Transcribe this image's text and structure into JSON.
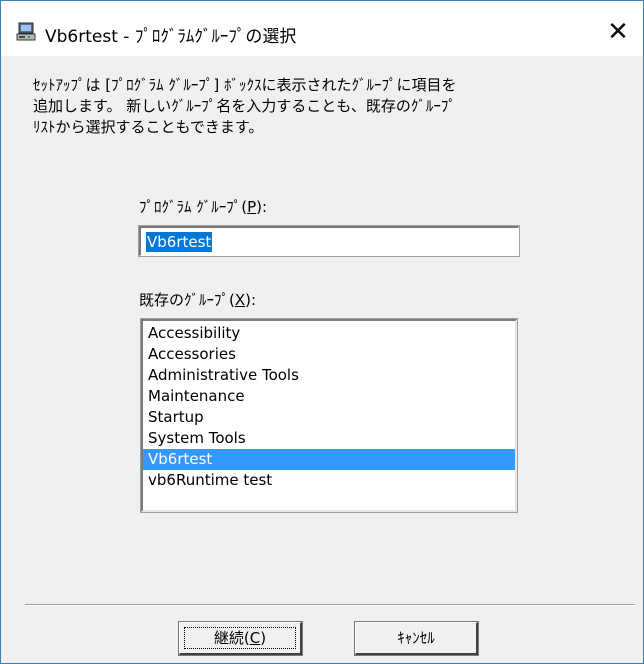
{
  "window": {
    "title": "Vb6rtest - ﾌﾟﾛｸﾞﾗﾑｸﾞﾙｰﾌﾟの選択",
    "close_glyph": "✕",
    "icon": "setup-computer-icon"
  },
  "instructions": "ｾｯﾄｱｯﾌﾟは [ﾌﾟﾛｸﾞﾗﾑ ｸﾞﾙｰﾌﾟ] ﾎﾞｯｸｽに表示されたｸﾞﾙｰﾌﾟに項目を\n追加します。 新しいｸﾞﾙｰﾌﾟ名を入力することも、既存のｸﾞﾙｰﾌﾟ\nﾘｽﾄから選択することもできます。",
  "program_group": {
    "label_pre": "ﾌﾟﾛｸﾞﾗﾑ ｸﾞﾙｰﾌﾟ(",
    "label_key": "P",
    "label_post": "):",
    "value": "Vb6rtest"
  },
  "existing_groups": {
    "label_pre": "既存のｸﾞﾙｰﾌﾟ(",
    "label_key": "X",
    "label_post": "):",
    "items": [
      {
        "label": "Accessibility"
      },
      {
        "label": "Accessories"
      },
      {
        "label": "Administrative Tools"
      },
      {
        "label": "Maintenance"
      },
      {
        "label": "Startup"
      },
      {
        "label": "System Tools"
      },
      {
        "label": "Vb6rtest"
      },
      {
        "label": "vb6Runtime test"
      }
    ],
    "selected": "Vb6rtest"
  },
  "buttons": {
    "continue_pre": "継続(",
    "continue_key": "C",
    "continue_post": ")",
    "cancel": "ｷｬﾝｾﾙ"
  },
  "colors": {
    "selection": "#3399ff",
    "text_selection": "#0078d7",
    "window_border": "#3c7fb1"
  }
}
